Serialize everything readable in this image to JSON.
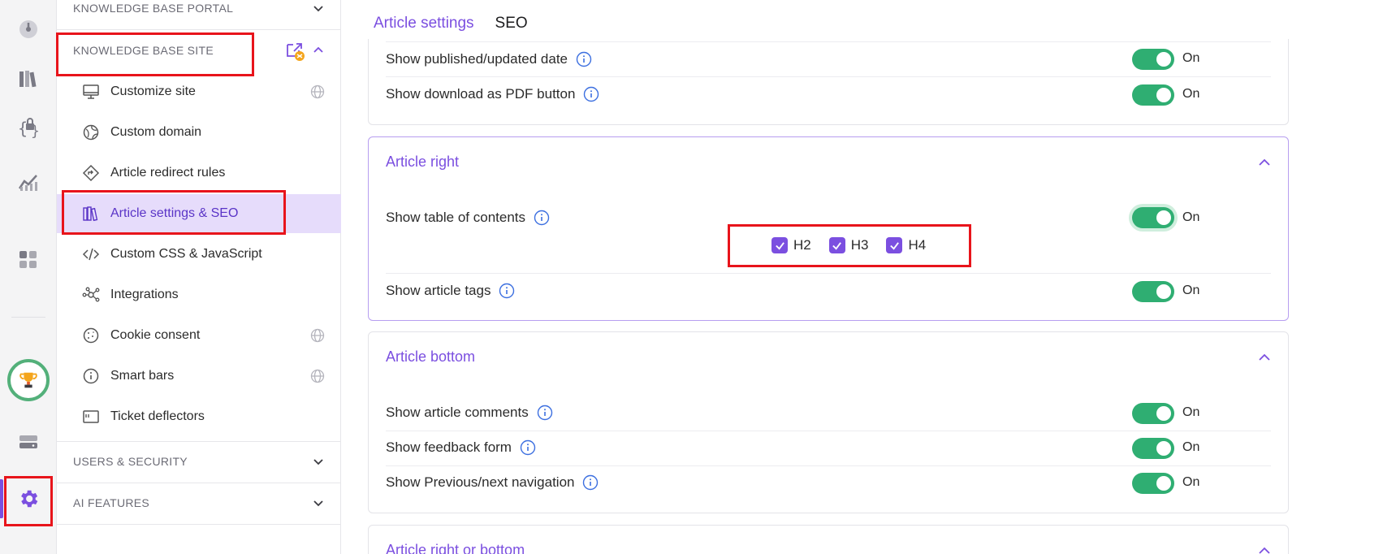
{
  "sidebar": {
    "sections": {
      "portal": "KNOWLEDGE BASE PORTAL",
      "site": "KNOWLEDGE BASE SITE",
      "users": "USERS & SECURITY",
      "ai": "AI FEATURES"
    },
    "items": [
      {
        "label": "Customize site",
        "icon": "monitor-icon"
      },
      {
        "label": "Custom domain",
        "icon": "domain-icon"
      },
      {
        "label": "Article redirect rules",
        "icon": "redirect-icon"
      },
      {
        "label": "Article settings & SEO",
        "icon": "books-icon"
      },
      {
        "label": "Custom CSS & JavaScript",
        "icon": "code-icon"
      },
      {
        "label": "Integrations",
        "icon": "integrations-icon"
      },
      {
        "label": "Cookie consent",
        "icon": "cookie-icon"
      },
      {
        "label": "Smart bars",
        "icon": "info-icon"
      },
      {
        "label": "Ticket deflectors",
        "icon": "ticket-icon"
      }
    ]
  },
  "main": {
    "tabs": {
      "article_settings": "Article settings",
      "seo": "SEO"
    },
    "top_card": {
      "rows": [
        {
          "label": "Show published/updated date",
          "state": "On"
        },
        {
          "label": "Show download as PDF button",
          "state": "On"
        }
      ]
    },
    "article_right": {
      "title": "Article right",
      "rows": [
        {
          "label": "Show table of contents",
          "state": "On"
        },
        {
          "label": "Show article tags",
          "state": "On"
        }
      ],
      "headings": [
        "H2",
        "H3",
        "H4"
      ]
    },
    "article_bottom": {
      "title": "Article bottom",
      "rows": [
        {
          "label": "Show article comments",
          "state": "On"
        },
        {
          "label": "Show feedback form",
          "state": "On"
        },
        {
          "label": "Show Previous/next navigation",
          "state": "On"
        }
      ]
    },
    "article_right_or_bottom": {
      "title": "Article right or bottom"
    }
  },
  "colors": {
    "accent": "#7b4fe0",
    "toggle_on": "#2fae72",
    "highlight": "#e8141b"
  }
}
